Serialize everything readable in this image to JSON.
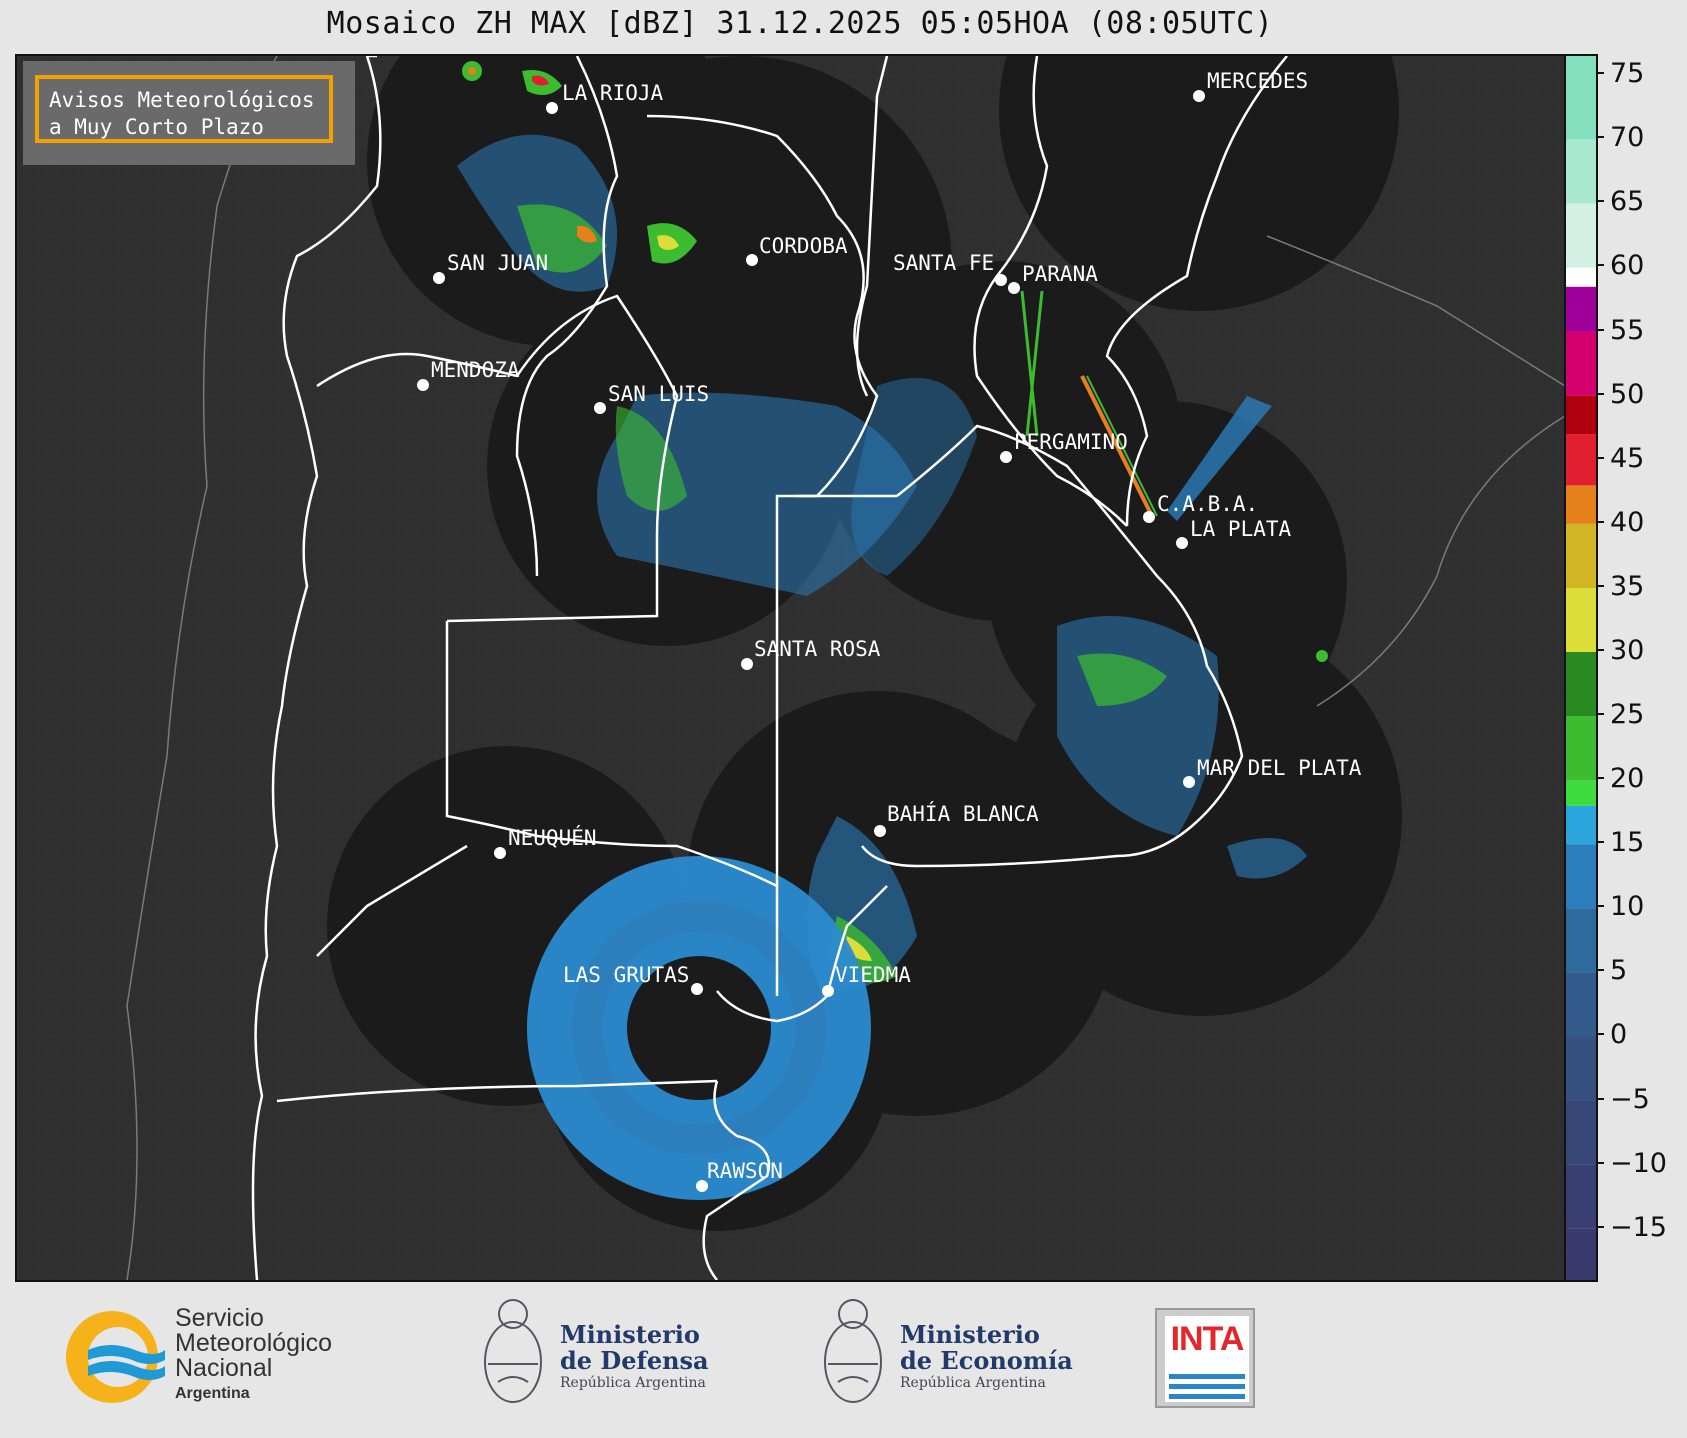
{
  "title": "Mosaico ZH MAX [dBZ] 31.12.2025 05:05HOA (08:05UTC)",
  "notice": {
    "line1": "Avisos Meteorológicos",
    "line2": "a Muy Corto Plazo",
    "border_color": "#f2a100"
  },
  "cities": [
    {
      "name": "LA RIOJA"
    },
    {
      "name": "MERCEDES"
    },
    {
      "name": "SAN JUAN"
    },
    {
      "name": "CORDOBA"
    },
    {
      "name": "SANTA FE"
    },
    {
      "name": "PARANA"
    },
    {
      "name": "MENDOZA"
    },
    {
      "name": "SAN LUIS"
    },
    {
      "name": "PERGAMINO"
    },
    {
      "name": "C.A.B.A."
    },
    {
      "name": "LA PLATA"
    },
    {
      "name": "SANTA ROSA"
    },
    {
      "name": "MAR DEL PLATA"
    },
    {
      "name": "BAHÍA BLANCA"
    },
    {
      "name": "NEUQUÉN"
    },
    {
      "name": "LAS GRUTAS"
    },
    {
      "name": "VIEDMA"
    },
    {
      "name": "RAWSON"
    }
  ],
  "colorbar": {
    "unit": "dBZ",
    "min": -19,
    "max": 76.5,
    "ticks": [
      "75",
      "70",
      "65",
      "60",
      "55",
      "50",
      "45",
      "40",
      "35",
      "30",
      "25",
      "20",
      "15",
      "10",
      "5",
      "0",
      "−5",
      "−10",
      "−15"
    ],
    "tick_values": [
      75,
      70,
      65,
      60,
      55,
      50,
      45,
      40,
      35,
      30,
      25,
      20,
      15,
      10,
      5,
      0,
      -5,
      -10,
      -15
    ],
    "bands": [
      {
        "from": -19,
        "to": -15,
        "color": "#3a3a6e"
      },
      {
        "from": -15,
        "to": -10,
        "color": "#393f72"
      },
      {
        "from": -10,
        "to": -5,
        "color": "#374778"
      },
      {
        "from": -5,
        "to": 0,
        "color": "#36507f"
      },
      {
        "from": 0,
        "to": 5,
        "color": "#335b8b"
      },
      {
        "from": 5,
        "to": 10,
        "color": "#2f6a9e"
      },
      {
        "from": 10,
        "to": 15,
        "color": "#2b7dbb"
      },
      {
        "from": 15,
        "to": 18,
        "color": "#2aa6dc"
      },
      {
        "from": 18,
        "to": 20,
        "color": "#3fdc3f"
      },
      {
        "from": 20,
        "to": 25,
        "color": "#3cbc2e"
      },
      {
        "from": 25,
        "to": 30,
        "color": "#2a8a22"
      },
      {
        "from": 30,
        "to": 35,
        "color": "#dddd3a"
      },
      {
        "from": 35,
        "to": 40,
        "color": "#d2b524"
      },
      {
        "from": 40,
        "to": 43,
        "color": "#e5801a"
      },
      {
        "from": 43,
        "to": 47,
        "color": "#e02030"
      },
      {
        "from": 47,
        "to": 50,
        "color": "#b00010"
      },
      {
        "from": 50,
        "to": 55,
        "color": "#d4006e"
      },
      {
        "from": 55,
        "to": 58.5,
        "color": "#a0009a"
      },
      {
        "from": 58.5,
        "to": 60,
        "color": "#ffffff"
      },
      {
        "from": 60,
        "to": 65,
        "color": "#d4f0e4"
      },
      {
        "from": 65,
        "to": 70,
        "color": "#a7e8cf"
      },
      {
        "from": 70,
        "to": 76.5,
        "color": "#84dfbe"
      }
    ]
  },
  "logos": {
    "smn": {
      "line1": "Servicio",
      "line2": "Meteorológico",
      "line3": "Nacional",
      "sub": "Argentina"
    },
    "defensa": {
      "line1": "Ministerio",
      "line2": "de Defensa",
      "sub": "República Argentina"
    },
    "economia": {
      "line1": "Ministerio",
      "line2": "de Economía",
      "sub": "República Argentina"
    },
    "inta": {
      "text": "INTA"
    }
  }
}
